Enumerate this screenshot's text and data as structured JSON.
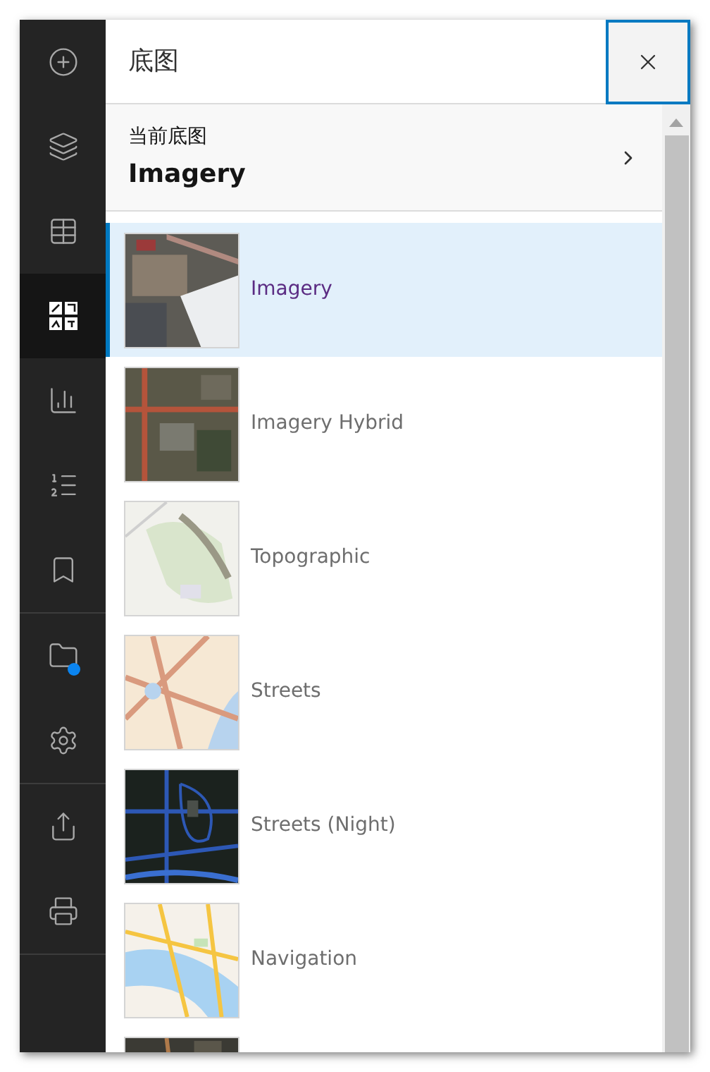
{
  "sidebar": {
    "groups": [
      {
        "items": [
          {
            "selected": false,
            "badge": false
          },
          {
            "selected": false,
            "badge": false
          },
          {
            "selected": false,
            "badge": false
          },
          {
            "selected": true,
            "badge": false
          },
          {
            "selected": false,
            "badge": false
          },
          {
            "selected": false,
            "badge": false
          },
          {
            "selected": false,
            "badge": false
          }
        ]
      },
      {
        "items": [
          {
            "selected": false,
            "badge": true
          },
          {
            "selected": false,
            "badge": false
          }
        ]
      },
      {
        "items": [
          {
            "selected": false,
            "badge": false
          },
          {
            "selected": false,
            "badge": false
          }
        ]
      }
    ]
  },
  "panel": {
    "title": "底图",
    "current": {
      "label": "当前底图",
      "value": "Imagery"
    },
    "basemaps": [
      {
        "label": "Imagery",
        "selected": true
      },
      {
        "label": "Imagery Hybrid",
        "selected": false
      },
      {
        "label": "Topographic",
        "selected": false
      },
      {
        "label": "Streets",
        "selected": false
      },
      {
        "label": "Streets (Night)",
        "selected": false
      },
      {
        "label": "Navigation",
        "selected": false
      },
      {
        "selected": false
      }
    ]
  }
}
